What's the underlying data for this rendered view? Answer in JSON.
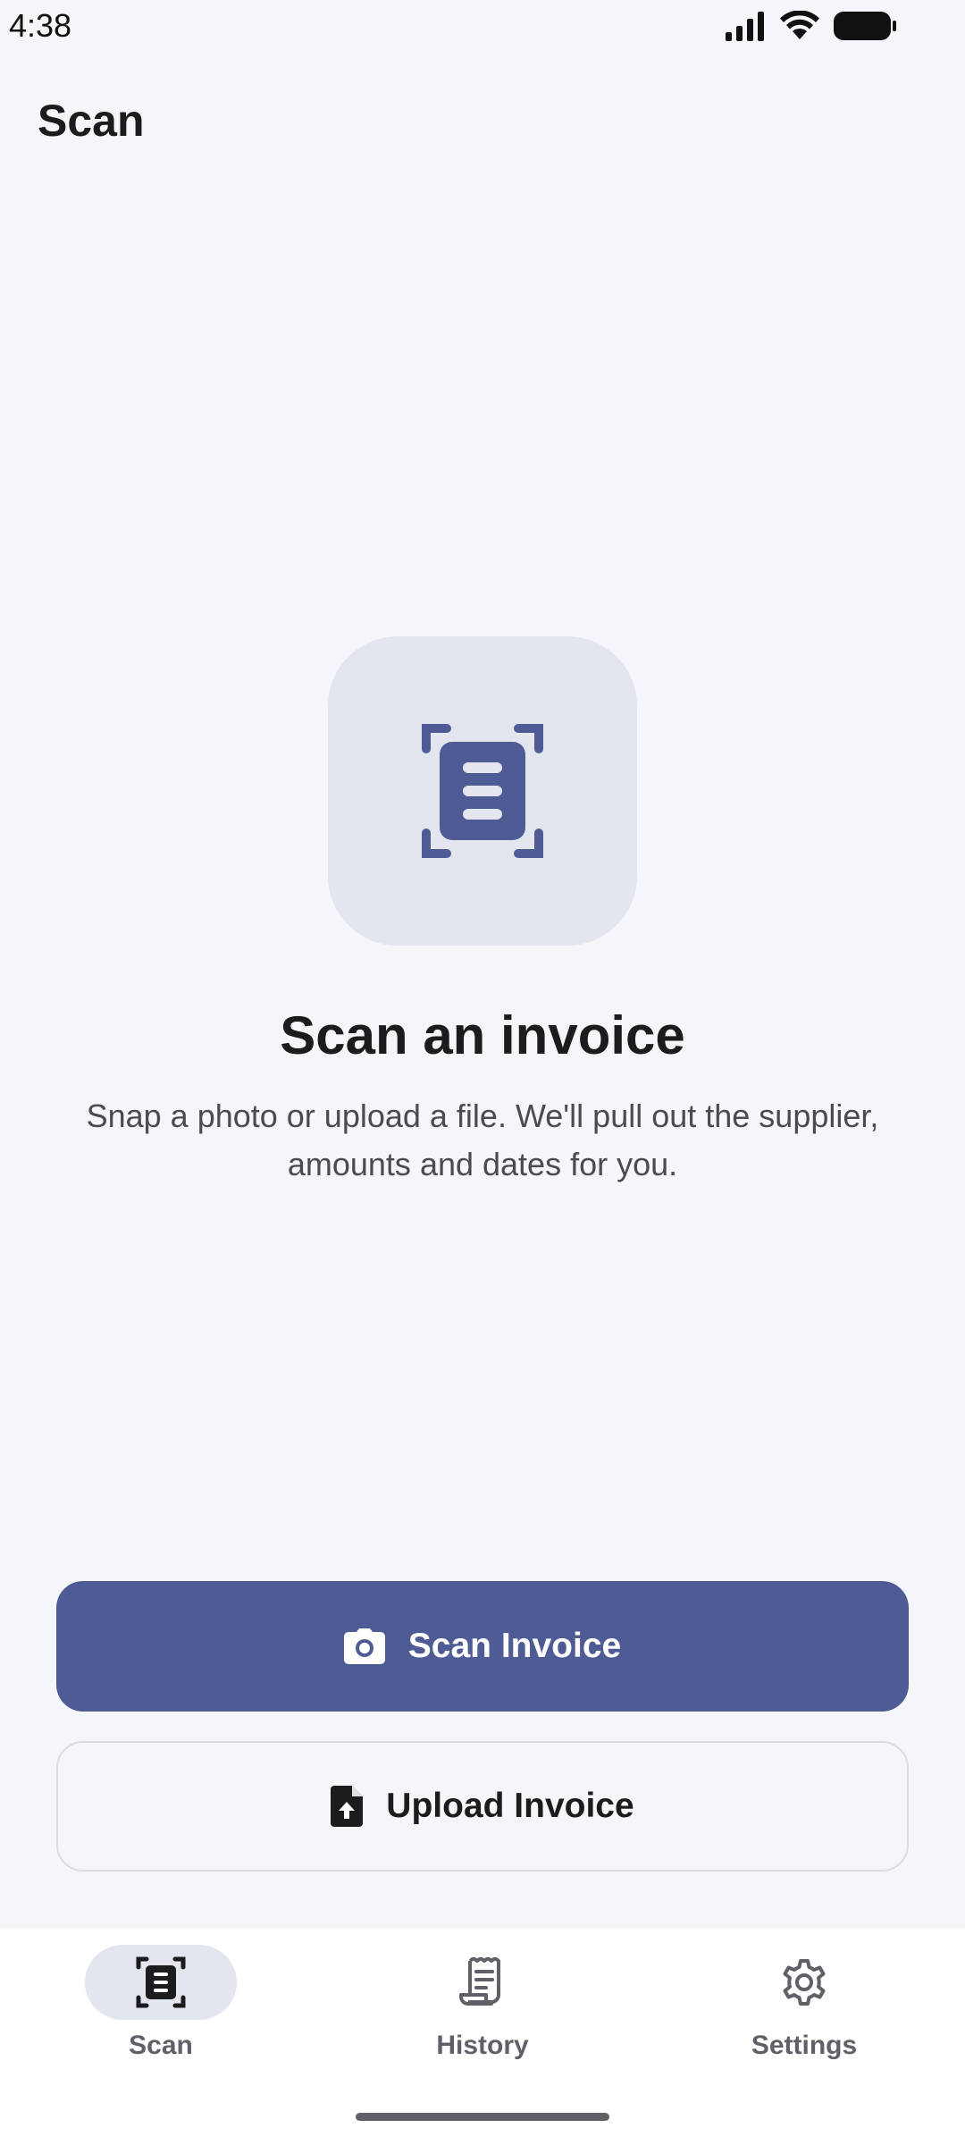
{
  "status_bar": {
    "time": "4:38"
  },
  "app_bar": {
    "title": "Scan"
  },
  "empty_state": {
    "icon": "document-scanner-icon",
    "title": "Scan an invoice",
    "description": "Snap a photo or upload a file. We'll pull out the supplier, amounts and dates for you."
  },
  "actions": {
    "scan_label": "Scan Invoice",
    "scan_icon": "camera-icon",
    "upload_label": "Upload Invoice",
    "upload_icon": "file-upload-icon"
  },
  "bottom_nav": {
    "items": [
      {
        "label": "Scan",
        "icon": "document-scanner-icon",
        "active": true
      },
      {
        "label": "History",
        "icon": "receipt-icon",
        "active": false
      },
      {
        "label": "Settings",
        "icon": "gear-icon",
        "active": false
      }
    ]
  },
  "colors": {
    "primary": "#4f5b94",
    "background": "#f5f6fa",
    "tile": "#e4e6ef"
  }
}
